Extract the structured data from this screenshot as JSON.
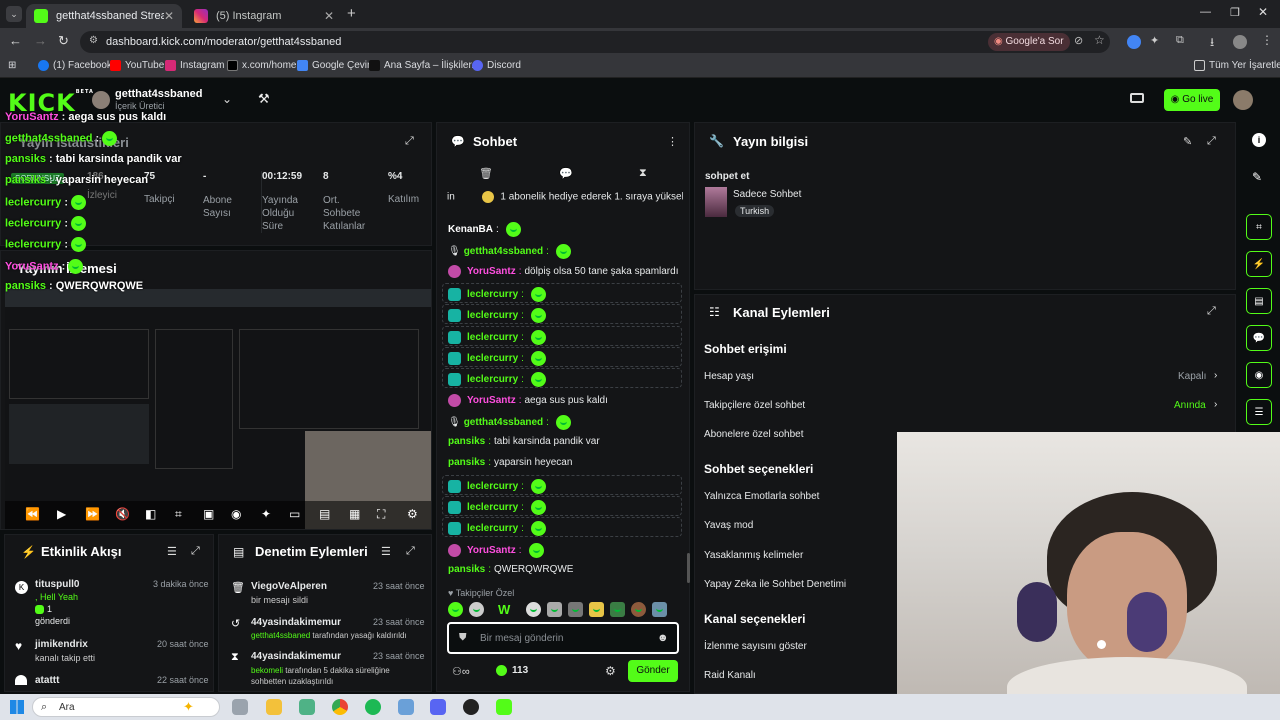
{
  "browser": {
    "tabs": [
      {
        "title": "getthat4ssbaned Stream - Kick",
        "active": true
      },
      {
        "title": "(5) Instagram",
        "active": false
      }
    ],
    "url": "dashboard.kick.com/moderator/getthat4ssbaned",
    "google_btn": "Google'a Sor",
    "bookmarks": [
      "(1) Facebook",
      "YouTube",
      "Instagram",
      "x.com/home",
      "Google Çeviri",
      "Ana Sayfa – İlişkiler...",
      "Discord"
    ],
    "all_bookmarks": "Tüm Yer İşaretleri"
  },
  "header": {
    "logo": "KICK",
    "logo_badge": "BETA",
    "channel_name": "getthat4ssbaned",
    "channel_role": "İçerik Üretici",
    "go_live": "Go live"
  },
  "stats": {
    "title": "Yayın İstatistikleri",
    "items": [
      {
        "value": "186",
        "label": "İzleyici"
      },
      {
        "value": "75",
        "label": "Takipçi"
      },
      {
        "value": "-",
        "label": "Abone Sayısı"
      },
      {
        "value": "00:12:59",
        "label": "Yayında Olduğu Süre"
      },
      {
        "value": "8",
        "label": "Ort. Sohbete Katılanlar"
      },
      {
        "value": "%4",
        "label": "Katılım"
      }
    ],
    "live_badge": "SORUNSUZ"
  },
  "preview": {
    "title": "Yayının İzlemesi"
  },
  "overlay_chat": [
    {
      "user": "YoruSantz",
      "msg": "aega sus pus kaldı",
      "color": "#ff4fe0"
    },
    {
      "user": "getthat4ssbaned",
      "msg": "",
      "color": "#53fc18"
    },
    {
      "user": "pansiks",
      "msg": "tabi karsinda pandik var",
      "color": "#53fc18"
    },
    {
      "user": "pansiks",
      "msg": "yaparsin heyecan",
      "color": "#53fc18"
    },
    {
      "user": "leclercurry",
      "msg": "",
      "color": "#53fc18"
    },
    {
      "user": "leclercurry",
      "msg": "",
      "color": "#53fc18"
    },
    {
      "user": "leclercurry",
      "msg": "",
      "color": "#53fc18"
    },
    {
      "user": "YoruSantz",
      "msg": "",
      "color": "#ff4fe0"
    },
    {
      "user": "pansiks",
      "msg": "QWERQWRQWE",
      "color": "#53fc18"
    }
  ],
  "activity": {
    "title": "Etkinlik Akışı",
    "items": [
      {
        "user": "tituspull0",
        "time": "3 dakika önce",
        "line1": ", Hell Yeah",
        "line2": "1",
        "line3": "gönderdi"
      },
      {
        "user": "jimikendrix",
        "time": "20 saat önce",
        "line1": "kanalı takip etti"
      },
      {
        "user": "atattt",
        "time": "22 saat önce"
      }
    ]
  },
  "moderation": {
    "title": "Denetim Eylemleri",
    "items": [
      {
        "user": "ViegoVeAlperen",
        "time": "23 saat önce",
        "desc": "bir mesajı sildi"
      },
      {
        "user": "44yasindakimemur",
        "time": "23 saat önce",
        "highlight": "getthat4ssbaned",
        "desc": " tarafından yasağı kaldırıldı"
      },
      {
        "user": "44yasindakimemur",
        "time": "23 saat önce",
        "highlight": "bekomeli",
        "desc": " tarafından 5 dakika süreliğine sohbetten uzaklaştırıldı"
      }
    ]
  },
  "chat": {
    "title": "Sohbet",
    "pinned": "1 abonelik hediye ederek 1. sıraya yüksel",
    "pinned_prefix": "in",
    "messages": [
      {
        "user": "KenanBA",
        "msg": "",
        "color": "#ffffff"
      },
      {
        "user": "getthat4ssbaned",
        "msg": "",
        "color": "#53fc18"
      },
      {
        "user": "YoruSantz",
        "msg": "dölpiş olsa 50 tane şaka spamlardı",
        "color": "#ff4fe0"
      },
      {
        "user": "leclercurry",
        "msg": "",
        "color": "#53fc18"
      },
      {
        "user": "leclercurry",
        "msg": "",
        "color": "#53fc18"
      },
      {
        "user": "leclercurry",
        "msg": "",
        "color": "#53fc18"
      },
      {
        "user": "leclercurry",
        "msg": "",
        "color": "#53fc18"
      },
      {
        "user": "leclercurry",
        "msg": "",
        "color": "#53fc18"
      },
      {
        "user": "YoruSantz",
        "msg": "aega sus pus kaldı",
        "color": "#ff4fe0"
      },
      {
        "user": "getthat4ssbaned",
        "msg": "",
        "color": "#53fc18"
      },
      {
        "user": "pansiks",
        "msg": "tabi karsinda pandik var",
        "color": "#53fc18"
      },
      {
        "user": "pansiks",
        "msg": "yaparsin heyecan",
        "color": "#53fc18"
      },
      {
        "user": "leclercurry",
        "msg": "",
        "color": "#53fc18"
      },
      {
        "user": "leclercurry",
        "msg": "",
        "color": "#53fc18"
      },
      {
        "user": "leclercurry",
        "msg": "",
        "color": "#53fc18"
      },
      {
        "user": "YoruSantz",
        "msg": "",
        "color": "#ff4fe0"
      },
      {
        "user": "pansiks",
        "msg": "QWERQWRQWE",
        "color": "#53fc18"
      }
    ],
    "emote_section": "Takipçiler Özel",
    "placeholder": "Bir mesaj gönderin",
    "count": "113",
    "send": "Gönder"
  },
  "stream_info": {
    "title": "Yayın bilgisi",
    "stream_title": "sohpet et",
    "category": "Sadece Sohbet",
    "tag": "Turkish"
  },
  "channel_actions": {
    "title": "Kanal Eylemleri",
    "chat_access": "Sohbet erişimi",
    "account_age": "Hesap yaşı",
    "account_age_value": "Kapalı",
    "followers_only": "Takipçilere özel sohbet",
    "followers_only_value": "Anında",
    "subs_only": "Abonelere özel sohbet",
    "chat_options": "Sohbet seçenekleri",
    "emote_only": "Yalnızca Emotlarla sohbet",
    "slow_mode": "Yavaş mod",
    "banned_words": "Yasaklanmış kelimeler",
    "ai_moderation": "Yapay Zeka ile Sohbet Denetimi",
    "channel_options": "Kanal seçenekleri",
    "show_viewers": "İzlenme sayısını göster",
    "raid": "Raid Kanalı"
  },
  "taskbar": {
    "search": "Ara"
  }
}
